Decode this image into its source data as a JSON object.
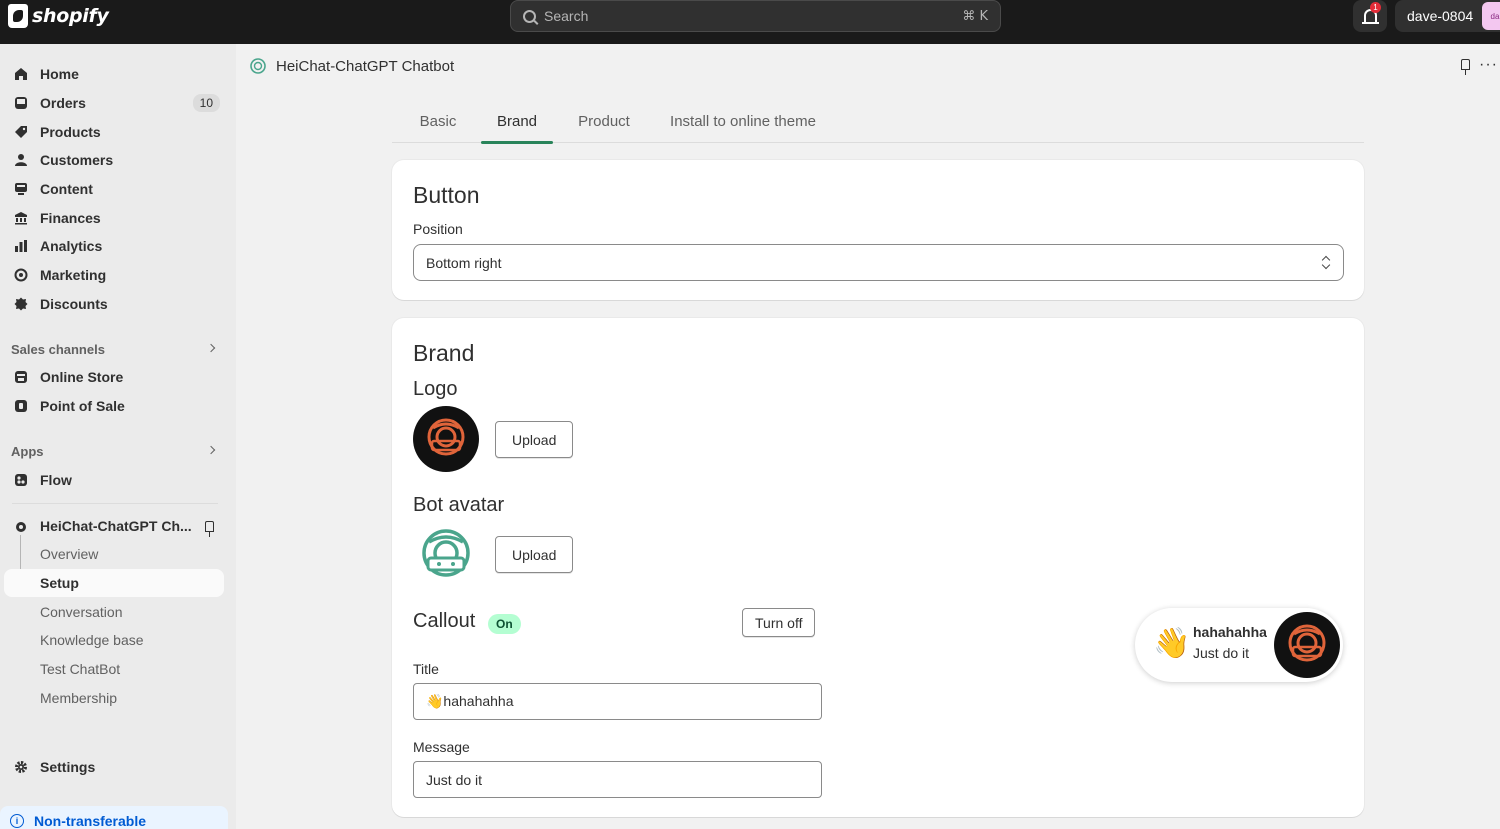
{
  "topbar": {
    "brand": "shopify",
    "search_placeholder": "Search",
    "search_shortcut": "⌘ K",
    "notification_count": "1",
    "store_name": "dave-0804",
    "avatar_initials": "da"
  },
  "sidebar": {
    "items": [
      {
        "label": "Home",
        "icon": "home-icon"
      },
      {
        "label": "Orders",
        "icon": "inbox-icon",
        "count": "10"
      },
      {
        "label": "Products",
        "icon": "tag-icon"
      },
      {
        "label": "Customers",
        "icon": "person-icon"
      },
      {
        "label": "Content",
        "icon": "monitor-icon"
      },
      {
        "label": "Finances",
        "icon": "bank-icon"
      },
      {
        "label": "Analytics",
        "icon": "bar-chart-icon"
      },
      {
        "label": "Marketing",
        "icon": "target-icon"
      },
      {
        "label": "Discounts",
        "icon": "discount-icon"
      }
    ],
    "sales_channels_label": "Sales channels",
    "sales_channels": [
      {
        "label": "Online Store",
        "icon": "store-icon"
      },
      {
        "label": "Point of Sale",
        "icon": "pos-icon"
      }
    ],
    "apps_label": "Apps",
    "apps": [
      {
        "label": "Flow",
        "icon": "flow-icon"
      }
    ],
    "pinned_app": {
      "label": "HeiChat-ChatGPT Ch...",
      "sub_items": [
        "Overview",
        "Setup",
        "Conversation",
        "Knowledge base",
        "Test ChatBot",
        "Membership"
      ],
      "active_sub": "Setup"
    },
    "settings_label": "Settings",
    "footer_notice": "Non-transferable"
  },
  "app_header": {
    "title": "HeiChat-ChatGPT Chatbot"
  },
  "tabs": [
    "Basic",
    "Brand",
    "Product",
    "Install to online theme"
  ],
  "active_tab": "Brand",
  "button_card": {
    "title": "Button",
    "position_label": "Position",
    "position_value": "Bottom right"
  },
  "brand_card": {
    "title": "Brand",
    "logo_label": "Logo",
    "logo_upload": "Upload",
    "avatar_label": "Bot avatar",
    "avatar_upload": "Upload",
    "callout_label": "Callout",
    "callout_status": "On",
    "callout_toggle": "Turn off",
    "title_label": "Title",
    "title_value": "👋hahahahha",
    "message_label": "Message",
    "message_value": "Just do it"
  },
  "preview": {
    "emoji": "👋",
    "title": "hahahahha",
    "message": "Just do it"
  },
  "colors": {
    "topbar": "#1a1a1a",
    "tab_accent": "#29845a",
    "logo_bg": "#111111",
    "logo_mark": "#e0643a",
    "avatar_mark": "#4aa58c",
    "on_badge": "#b4fed2"
  }
}
